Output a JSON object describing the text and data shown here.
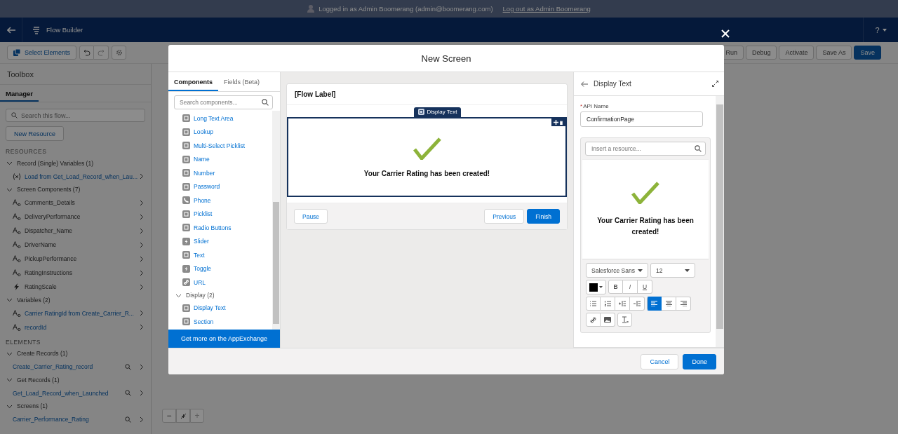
{
  "banner": {
    "text": "Logged in as Admin Boomerang (admin@boomerang.com)",
    "link": "Log out as Admin Boomerang"
  },
  "header": {
    "title": "Flow Builder",
    "help": "?"
  },
  "toolbar": {
    "select": "Select Elements",
    "actions": [
      {
        "label": "Run",
        "primary": false
      },
      {
        "label": "Debug",
        "primary": false
      },
      {
        "label": "Activate",
        "primary": false
      },
      {
        "label": "Save As",
        "primary": false
      },
      {
        "label": "Save",
        "primary": true
      }
    ]
  },
  "sidebar": {
    "title": "Toolbox",
    "tabs": [
      {
        "label": "Manager",
        "selected": true
      }
    ],
    "search": {
      "placeholder": "Search this flow..."
    },
    "new_resource": "New Resource",
    "sections": [
      {
        "heading": "RESOURCES",
        "groups": [
          {
            "label": "Record (Single) Variables (1)",
            "expanded": true,
            "children": [
              {
                "label": "Load from Get_Load_Record_when_Lau...",
                "kind": "record",
                "linked": true
              }
            ]
          },
          {
            "label": "Screen Components (7)",
            "expanded": true,
            "children": [
              {
                "label": "Comments_Details",
                "kind": "text",
                "linked": false
              },
              {
                "label": "DeliveryPerformance",
                "kind": "text",
                "linked": false
              },
              {
                "label": "Dispatcher_Name",
                "kind": "text",
                "linked": false
              },
              {
                "label": "DriverName",
                "kind": "text",
                "linked": false
              },
              {
                "label": "PickupPerformance",
                "kind": "text",
                "linked": false
              },
              {
                "label": "RatingInstructions",
                "kind": "text",
                "linked": false
              },
              {
                "label": "RatingScale",
                "kind": "bolt",
                "linked": false
              }
            ]
          },
          {
            "label": "Variables (2)",
            "expanded": true,
            "children": [
              {
                "label": "Carrier RatingId from Create_Carrier_R...",
                "kind": "text",
                "linked": true
              },
              {
                "label": "recordId",
                "kind": "text",
                "linked": true
              }
            ]
          }
        ]
      },
      {
        "heading": "ELEMENTS",
        "groups": [
          {
            "label": "Create Records (1)",
            "expanded": true,
            "children": [
              {
                "label": "Create_Carrier_Rating_record",
                "kind": "element",
                "linked": true
              }
            ]
          },
          {
            "label": "Get Records (1)",
            "expanded": true,
            "children": [
              {
                "label": "Get_Load_Record_when_Launched",
                "kind": "element",
                "linked": true
              }
            ]
          },
          {
            "label": "Screens (1)",
            "expanded": true,
            "children": [
              {
                "label": "Carrier_Performance_Rating",
                "kind": "element",
                "linked": true
              }
            ]
          }
        ]
      }
    ]
  },
  "zoom": {
    "out": "−",
    "in": "+"
  },
  "modal": {
    "title": "New Screen",
    "palette": {
      "tabs": [
        {
          "label": "Components",
          "selected": true
        },
        {
          "label": "Fields (Beta)",
          "selected": false
        }
      ],
      "search": {
        "placeholder": "Search components..."
      },
      "items": [
        {
          "label": "Long Text Area",
          "kind": "field"
        },
        {
          "label": "Lookup",
          "kind": "field"
        },
        {
          "label": "Multi-Select Picklist",
          "kind": "field"
        },
        {
          "label": "Name",
          "kind": "field"
        },
        {
          "label": "Number",
          "kind": "field"
        },
        {
          "label": "Password",
          "kind": "field"
        },
        {
          "label": "Phone",
          "kind": "phone"
        },
        {
          "label": "Picklist",
          "kind": "field"
        },
        {
          "label": "Radio Buttons",
          "kind": "field"
        },
        {
          "label": "Slider",
          "kind": "bolt"
        },
        {
          "label": "Text",
          "kind": "field"
        },
        {
          "label": "Toggle",
          "kind": "bolt"
        },
        {
          "label": "URL",
          "kind": "link"
        }
      ],
      "groups": [
        {
          "label": "Display (2)",
          "expanded": true,
          "children": [
            {
              "label": "Display Text",
              "kind": "field"
            },
            {
              "label": "Section",
              "kind": "field"
            }
          ]
        }
      ],
      "appexchange": "Get more on the AppExchange"
    },
    "canvas": {
      "flow_label": "[Flow Label]",
      "component": {
        "tag": "Display Text",
        "selected": true,
        "message": "Your Carrier Rating has been created!"
      },
      "left_buttons": [
        {
          "label": "Pause",
          "kind": "neutral"
        }
      ],
      "right_buttons": [
        {
          "label": "Previous",
          "kind": "neutral"
        },
        {
          "label": "Finish",
          "kind": "brand"
        }
      ]
    },
    "properties": {
      "title": "Display Text",
      "api_name": {
        "label": "API Name",
        "required_mark": "*",
        "value": "ConfirmationPage"
      },
      "editor": {
        "resource": {
          "placeholder": "Insert a resource..."
        },
        "message": "Your Carrier Rating has been created!",
        "font": "Salesforce Sans",
        "size": "12",
        "color": "#000000",
        "format": [
          "B",
          "I",
          "U"
        ],
        "align": [
          {
            "kind": "left",
            "selected": true
          },
          {
            "kind": "center",
            "selected": false
          },
          {
            "kind": "right",
            "selected": false
          }
        ]
      }
    },
    "footer": [
      {
        "label": "Cancel",
        "kind": "neutral"
      },
      {
        "label": "Done",
        "kind": "brand"
      }
    ]
  }
}
